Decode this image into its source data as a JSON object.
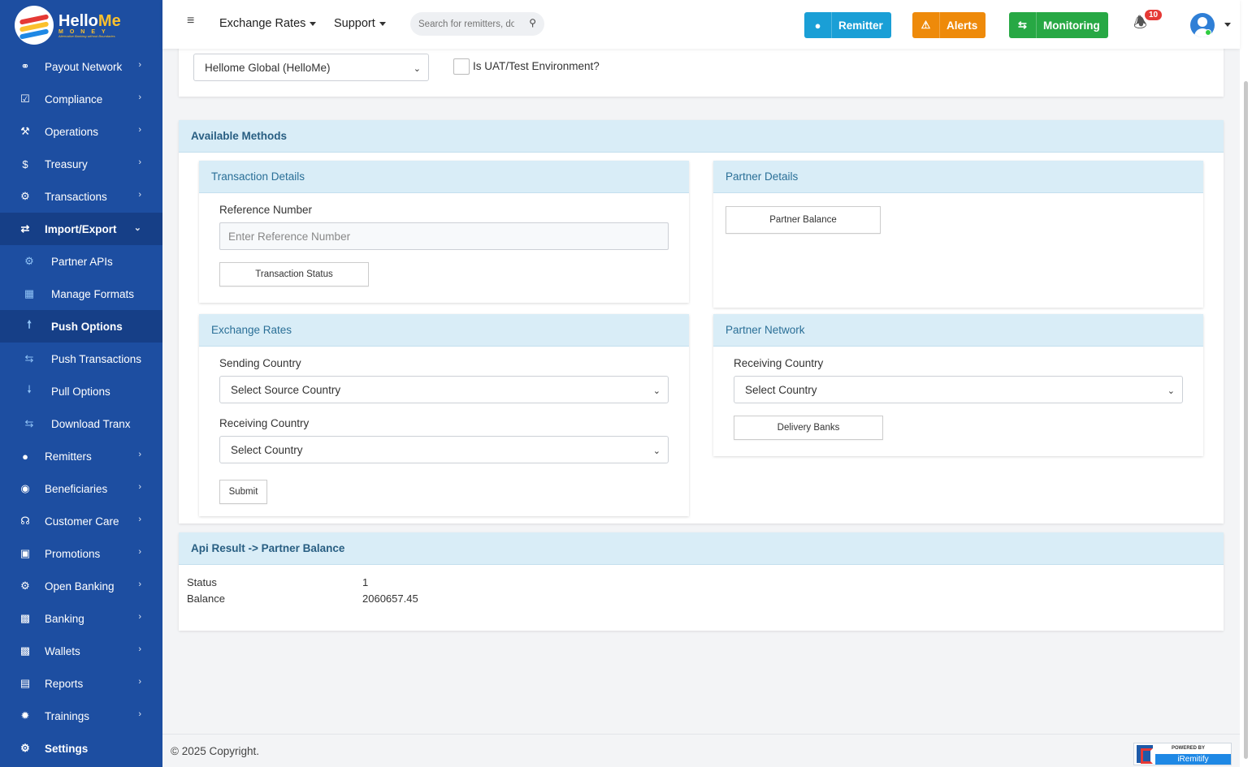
{
  "brand": {
    "name_part1": "Hello",
    "name_part2": "Me",
    "sub": "MONEY",
    "tagline": "Alternative Banking without Boundaries"
  },
  "sidebar": {
    "items": [
      {
        "label": "Payout Network",
        "icon": "handshake-icon"
      },
      {
        "label": "Compliance",
        "icon": "check-square-icon"
      },
      {
        "label": "Operations",
        "icon": "wrench-icon"
      },
      {
        "label": "Treasury",
        "icon": "dollar-icon"
      },
      {
        "label": "Transactions",
        "icon": "cogs-icon"
      },
      {
        "label": "Import/Export",
        "icon": "shuffle-icon"
      },
      {
        "label": "Partner APIs",
        "icon": "gear-icon"
      },
      {
        "label": "Manage Formats",
        "icon": "excel-file-icon"
      },
      {
        "label": "Push Options",
        "icon": "arrow-up-icon"
      },
      {
        "label": "Push Transactions",
        "icon": "exchange-icon"
      },
      {
        "label": "Pull Options",
        "icon": "arrow-down-icon"
      },
      {
        "label": "Download Tranx",
        "icon": "exchange-icon"
      },
      {
        "label": "Remitters",
        "icon": "users-icon"
      },
      {
        "label": "Beneficiaries",
        "icon": "user-circle-icon"
      },
      {
        "label": "Customer Care",
        "icon": "headset-icon"
      },
      {
        "label": "Promotions",
        "icon": "gift-icon"
      },
      {
        "label": "Open Banking",
        "icon": "gear-icon"
      },
      {
        "label": "Banking",
        "icon": "money-bill-icon"
      },
      {
        "label": "Wallets",
        "icon": "money-bill-icon"
      },
      {
        "label": "Reports",
        "icon": "bar-chart-icon"
      },
      {
        "label": "Trainings",
        "icon": "cog-icon"
      },
      {
        "label": "Settings",
        "icon": "cogs-icon"
      }
    ]
  },
  "topbar": {
    "menu1": "Exchange Rates",
    "menu2": "Support",
    "search_placeholder": "Search for remitters, docs...",
    "remitter_label": "Remitter",
    "alerts_label": "Alerts",
    "monitoring_label": "Monitoring",
    "notif_count": "10",
    "colors": {
      "remitter": "#1a9fd6",
      "alerts": "#ee8a0a",
      "monitoring": "#27a844"
    }
  },
  "filters": {
    "partner_selected": "Hellome Global (HelloMe)",
    "uat_label": "Is UAT/Test Environment?"
  },
  "methods": {
    "title": "Available Methods",
    "transaction": {
      "title": "Transaction Details",
      "ref_label": "Reference Number",
      "ref_placeholder": "Enter Reference Number",
      "status_button": "Transaction Status"
    },
    "partner": {
      "title": "Partner Details",
      "balance_button": "Partner Balance"
    },
    "exchange": {
      "title": "Exchange Rates",
      "sending_label": "Sending Country",
      "sending_value": "Select Source Country",
      "receiving_label": "Receiving Country",
      "receiving_value": "Select Country",
      "submit_button": "Submit"
    },
    "network": {
      "title": "Partner Network",
      "receiving_label": "Receiving Country",
      "receiving_value": "Select Country",
      "banks_button": "Delivery Banks"
    }
  },
  "result": {
    "title": "Api Result -> Partner Balance",
    "rows": [
      {
        "key": "Status",
        "value": "1"
      },
      {
        "key": "Balance",
        "value": "2060657.45"
      }
    ]
  },
  "footer": {
    "copyright": "© 2025 Copyright.",
    "powered_by": "POWERED BY",
    "powered_brand": "iRemitify"
  }
}
